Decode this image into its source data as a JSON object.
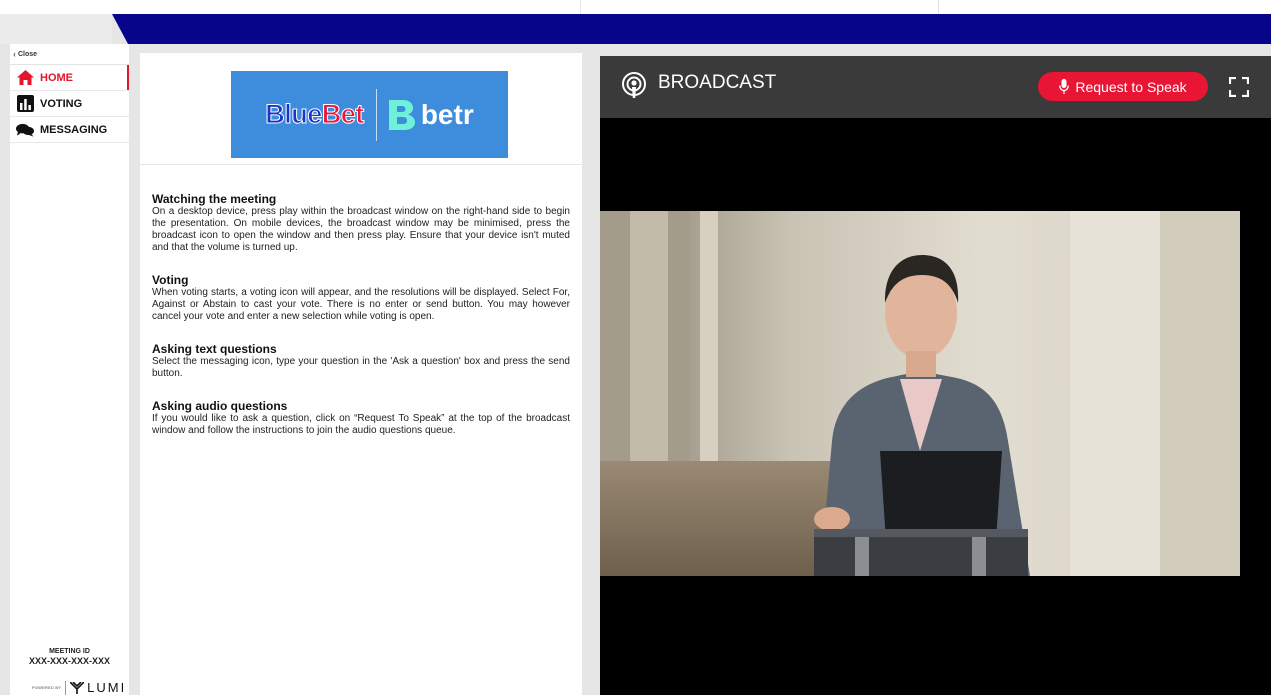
{
  "sidebar": {
    "close_label": "Close",
    "items": [
      {
        "label": "HOME",
        "icon": "home-icon",
        "active": true
      },
      {
        "label": "VOTING",
        "icon": "bar-chart-icon",
        "active": false
      },
      {
        "label": "MESSAGING",
        "icon": "chat-bubbles-icon",
        "active": false
      }
    ],
    "meeting_id_label": "MEETING ID",
    "meeting_id": "XXX-XXX-XXX-XXX",
    "powered_by": "POWERED BY",
    "brand": "LUMI"
  },
  "content": {
    "logo_left_a": "Blue",
    "logo_left_b": "Bet",
    "logo_right": "betr",
    "sections": [
      {
        "title": "Watching the meeting",
        "body": "On a desktop device, press play within the broadcast window on the right-hand side to begin the presentation. On mobile devices, the broadcast window may be minimised, press the broadcast icon to open the window and then press play. Ensure that your device isn't muted and that the volume is turned up."
      },
      {
        "title": "Voting",
        "body": "When voting starts, a voting icon will appear, and the resolutions will be displayed. Select For, Against or Abstain to cast your vote. There is no enter or send button. You may however cancel your vote and enter a new selection while voting is open."
      },
      {
        "title": "Asking text questions",
        "body": "Select the messaging icon, type your question in the 'Ask a question' box and press the send button."
      },
      {
        "title": "Asking audio questions",
        "body": "If you would like to ask a question, click on “Request To Speak” at the top of the broadcast window and follow the instructions to join the audio questions queue."
      }
    ]
  },
  "broadcast": {
    "title": "BROADCAST",
    "request_button": "Request to Speak",
    "colors": {
      "header": "#3a3a3a",
      "button": "#e81535",
      "topbar": "#07058a",
      "accent": "#e4162c"
    }
  }
}
